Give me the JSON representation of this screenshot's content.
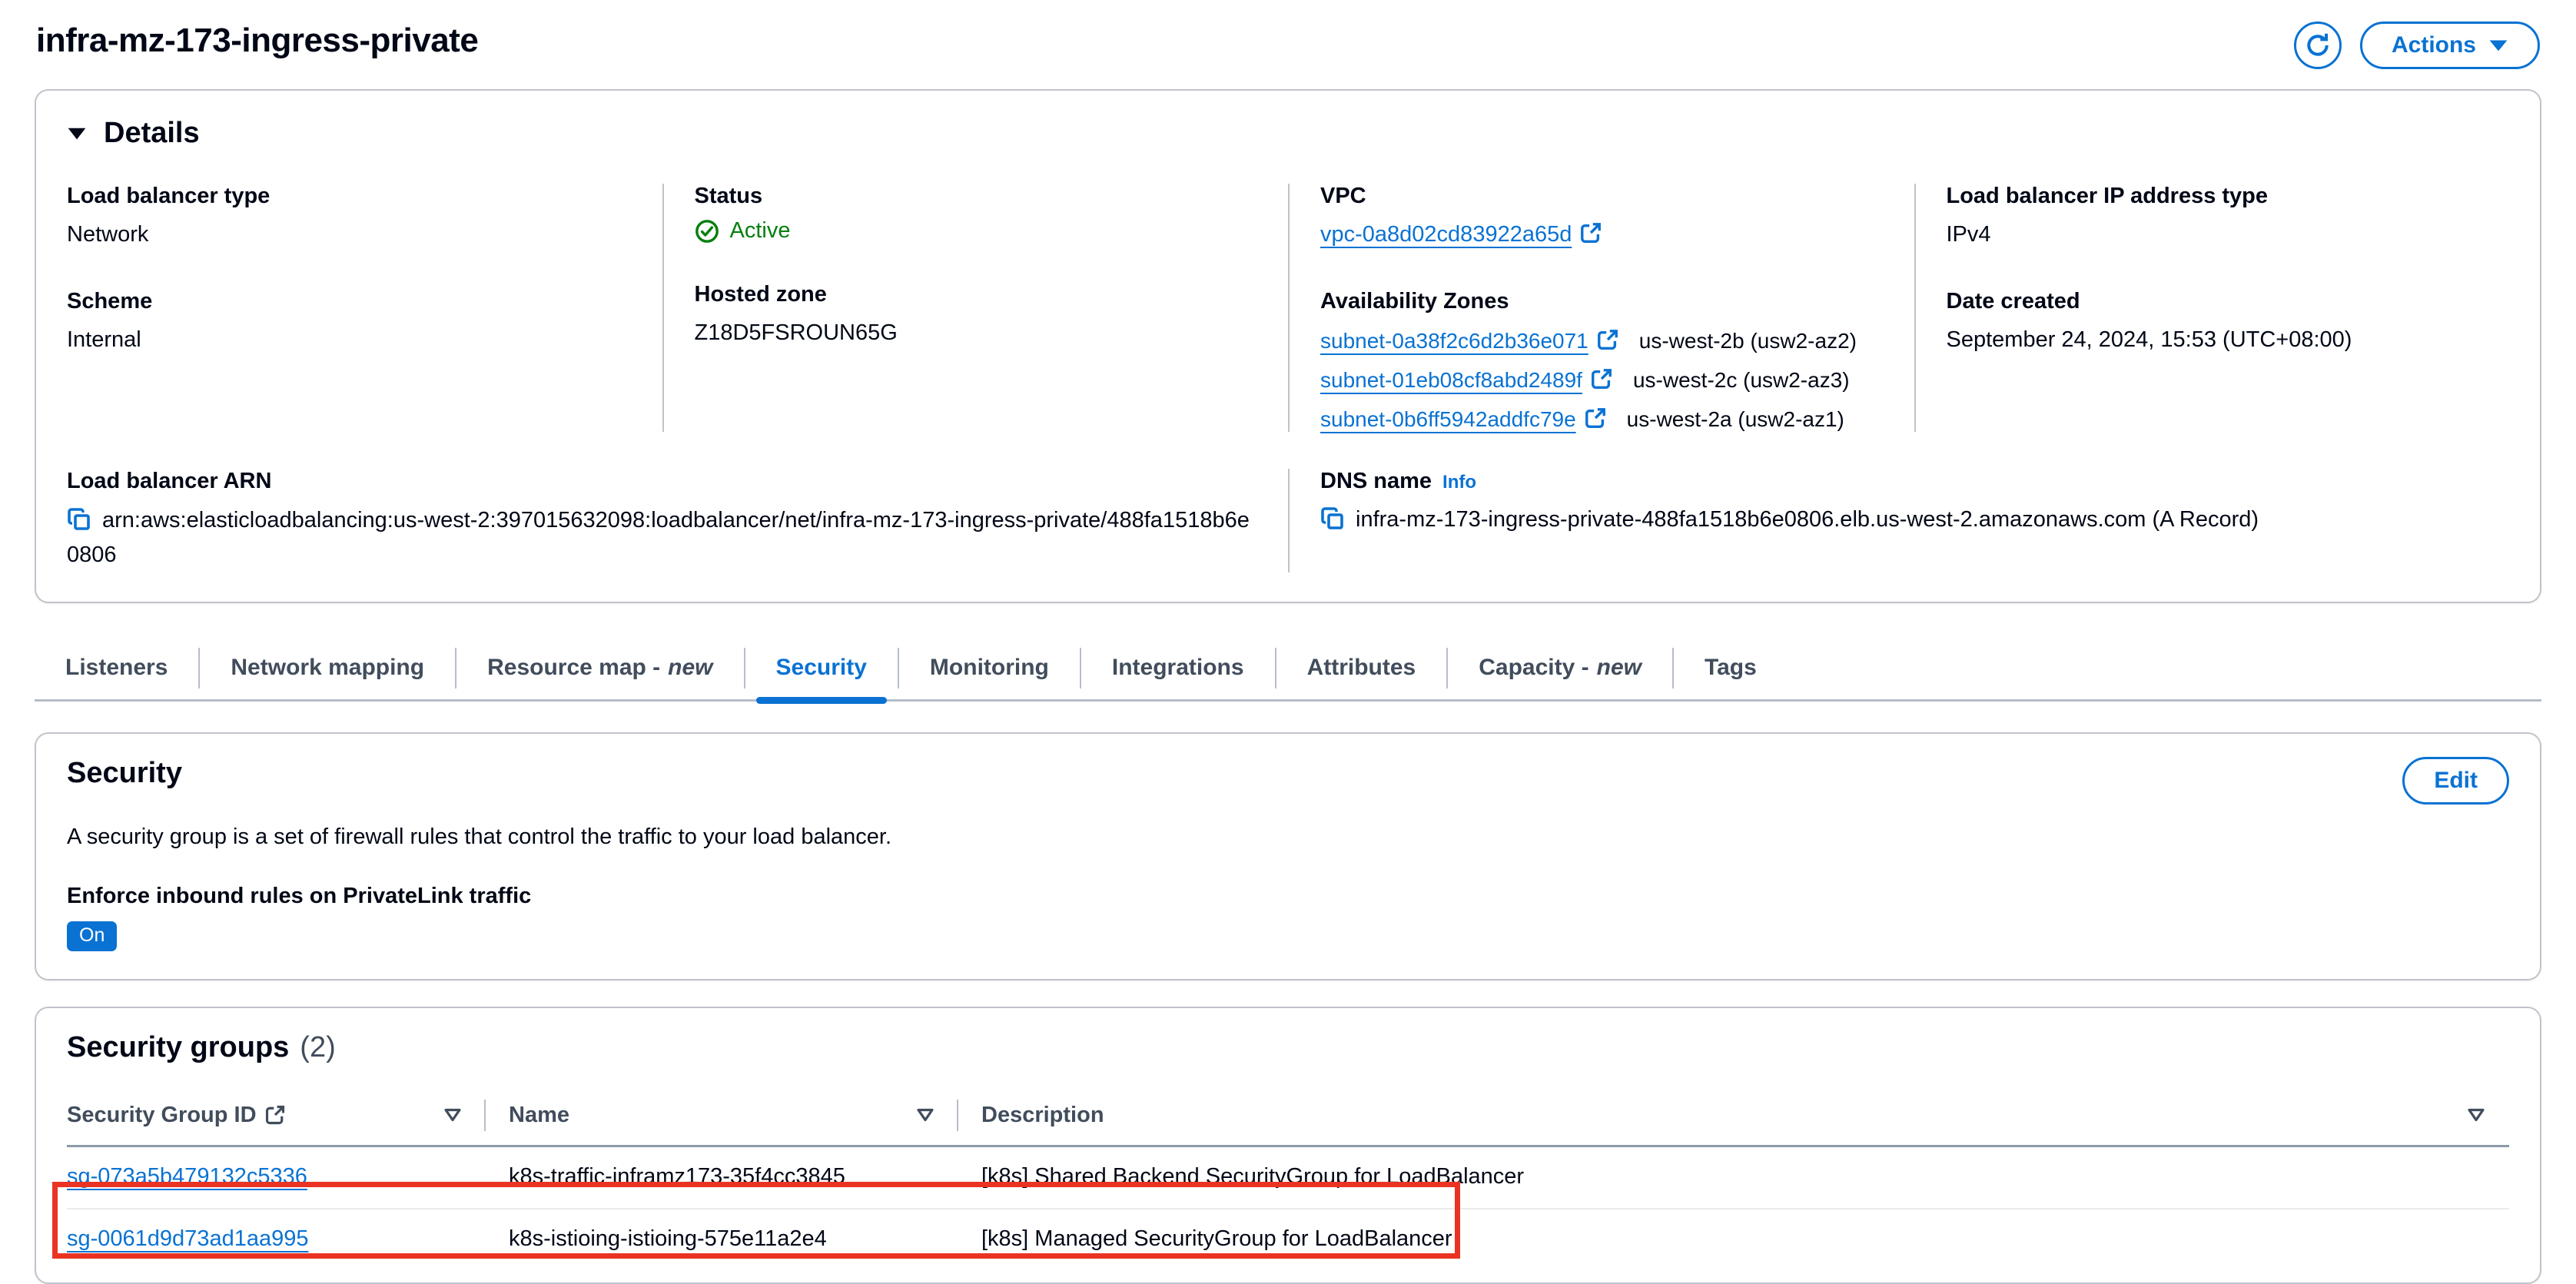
{
  "page": {
    "title": "infra-mz-173-ingress-private"
  },
  "header": {
    "actions_label": "Actions"
  },
  "details": {
    "title": "Details",
    "lb_type": {
      "label": "Load balancer type",
      "value": "Network"
    },
    "scheme": {
      "label": "Scheme",
      "value": "Internal"
    },
    "status": {
      "label": "Status",
      "value": "Active"
    },
    "hosted_zone": {
      "label": "Hosted zone",
      "value": "Z18D5FSROUN65G"
    },
    "vpc": {
      "label": "VPC",
      "value": "vpc-0a8d02cd83922a65d"
    },
    "azs": {
      "label": "Availability Zones",
      "subnets": [
        {
          "id": "subnet-0a38f2c6d2b36e071",
          "az": "us-west-2b (usw2-az2)"
        },
        {
          "id": "subnet-01eb08cf8abd2489f",
          "az": "us-west-2c (usw2-az3)"
        },
        {
          "id": "subnet-0b6ff5942addfc79e",
          "az": "us-west-2a (usw2-az1)"
        }
      ]
    },
    "ip_type": {
      "label": "Load balancer IP address type",
      "value": "IPv4"
    },
    "date_created": {
      "label": "Date created",
      "value": "September 24, 2024, 15:53 (UTC+08:00)"
    },
    "arn": {
      "label": "Load balancer ARN",
      "value": "arn:aws:elasticloadbalancing:us-west-2:397015632098:loadbalancer/net/infra-mz-173-ingress-private/488fa1518b6e0806"
    },
    "dns": {
      "label": "DNS name",
      "info_label": "Info",
      "value": "infra-mz-173-ingress-private-488fa1518b6e0806.elb.us-west-2.amazonaws.com (A Record)"
    }
  },
  "tabs": [
    {
      "label": "Listeners"
    },
    {
      "label": "Network mapping"
    },
    {
      "label": "Resource map -",
      "suffix": "new"
    },
    {
      "label": "Security",
      "active": true
    },
    {
      "label": "Monitoring"
    },
    {
      "label": "Integrations"
    },
    {
      "label": "Attributes"
    },
    {
      "label": "Capacity -",
      "suffix": "new"
    },
    {
      "label": "Tags"
    }
  ],
  "security": {
    "title": "Security",
    "edit_label": "Edit",
    "description": "A security group is a set of firewall rules that control the traffic to your load balancer.",
    "privatelink_label": "Enforce inbound rules on PrivateLink traffic",
    "privatelink_value": "On"
  },
  "security_groups": {
    "title": "Security groups",
    "count": "(2)",
    "columns": {
      "id": "Security Group ID",
      "name": "Name",
      "description": "Description"
    },
    "rows": [
      {
        "id": "sg-073a5b479132c5336",
        "name": "k8s-traffic-inframz173-35f4cc3845",
        "description": "[k8s] Shared Backend SecurityGroup for LoadBalancer"
      },
      {
        "id": "sg-0061d9d73ad1aa995",
        "name": "k8s-istioing-istioing-575e11a2e4",
        "description": "[k8s] Managed SecurityGroup for LoadBalancer"
      }
    ],
    "annotation": {
      "shape": "red-rectangle",
      "highlighted_row": "sg-0061d9d73ad1aa995",
      "color": "#ea3323"
    }
  },
  "colors": {
    "accent_blue": "#0972d3",
    "success_green": "#037f0c",
    "text_dark": "#000716",
    "text_secondary": "#414d5c",
    "panel_border": "#c0c3cb",
    "annotation_red": "#ea3323"
  }
}
